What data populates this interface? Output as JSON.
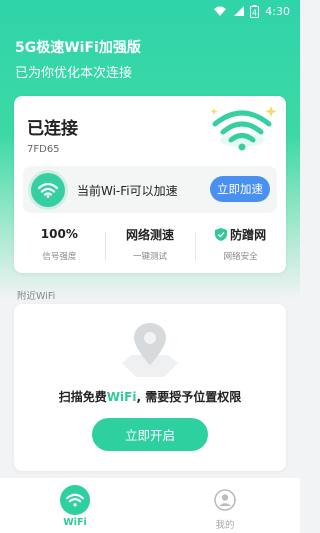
{
  "status_bar": {
    "time": "4:30",
    "battery": "4"
  },
  "header": {
    "title": "5G极速WiFi加强版",
    "subtitle": "已为你优化本次连接"
  },
  "connection": {
    "status": "已连接",
    "ssid": "7FD65",
    "accel_text": "当前Wi-Fi可以加速",
    "accel_button": "立即加速"
  },
  "stats": [
    {
      "value": "100%",
      "label": "信号强度"
    },
    {
      "value": "网络测速",
      "label": "一键测试"
    },
    {
      "value": "防蹭网",
      "label": "网络安全"
    }
  ],
  "nearby": {
    "label": "附近WiFi",
    "scan_prefix": "扫描免费",
    "scan_highlight": "WiFi",
    "scan_suffix": ", 需要授予位置权限",
    "open_button": "立即开启"
  },
  "nav": [
    {
      "label": "WiFi",
      "icon": "wifi-icon",
      "active": true
    },
    {
      "label": "我的",
      "icon": "user-icon",
      "active": false
    }
  ],
  "colors": {
    "accent": "#2fd0a0",
    "button_blue": "#4a90f0",
    "inactive": "#aaaaaa"
  }
}
